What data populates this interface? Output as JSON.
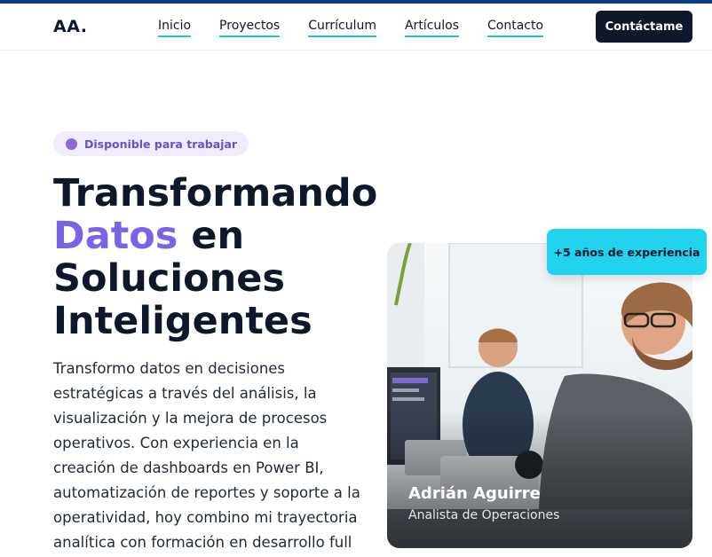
{
  "colors": {
    "top_stripe": "#0b3a7e",
    "dark": "#0f172a",
    "accent_purple": "#7b63e6",
    "nav_underline": "#22c1dc",
    "badge_bg": "#f1ecfd",
    "exp_badge_bg": "#22d3ee"
  },
  "header": {
    "logo": "AA.",
    "nav": [
      {
        "label": "Inicio"
      },
      {
        "label": "Proyectos"
      },
      {
        "label": "Currículum"
      },
      {
        "label": "Artículos"
      },
      {
        "label": "Contacto"
      }
    ],
    "cta_label": "Contáctame"
  },
  "hero": {
    "availability_badge": "Disponible para trabajar",
    "headline": {
      "line1": "Transformando",
      "line2_accent": "Datos",
      "line2_rest": " en",
      "line3_accent": "Soluciones",
      "line4": "Inteligentes"
    },
    "description": "Transformo datos en decisiones estratégicas a través del análisis, la visualización y la mejora de procesos operativos. Con experiencia en la creación de dashboards en Power BI, automatización de reportes y soporte a la operatividad, hoy combino mi trayectoria analítica con formación en desarrollo full"
  },
  "profile_card": {
    "name": "Adrián Aguirre",
    "role": "Analista de Operaciones",
    "experience_badge": "+5 años de experiencia"
  }
}
